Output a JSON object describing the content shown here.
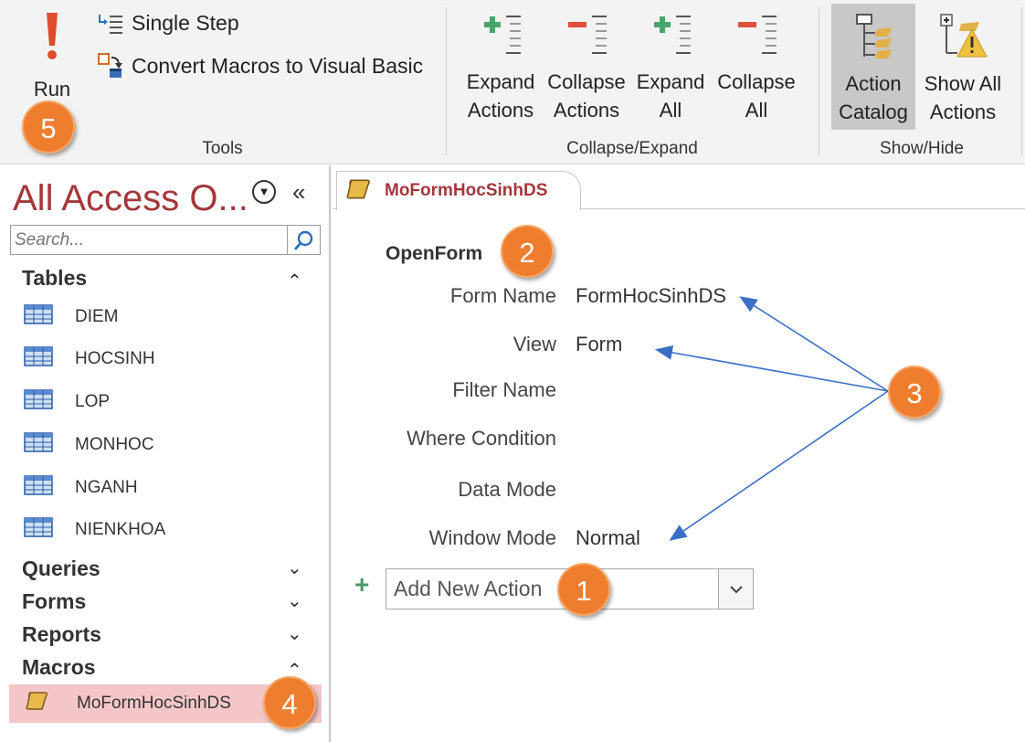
{
  "ribbon": {
    "tools": {
      "run_label": "Run",
      "single_step_label": "Single Step",
      "convert_label": "Convert Macros to Visual Basic",
      "group_label": "Tools"
    },
    "collapse_expand": {
      "expand_actions": [
        "Expand",
        "Actions"
      ],
      "collapse_actions": [
        "Collapse",
        "Actions"
      ],
      "expand_all": [
        "Expand",
        "All"
      ],
      "collapse_all": [
        "Collapse",
        "All"
      ],
      "group_label": "Collapse/Expand"
    },
    "show_hide": {
      "action_catalog": [
        "Action",
        "Catalog"
      ],
      "show_all_actions": [
        "Show All",
        "Actions"
      ],
      "group_label": "Show/Hide"
    }
  },
  "nav": {
    "title": "All Access O...",
    "search_placeholder": "Search...",
    "sections": {
      "tables": "Tables",
      "queries": "Queries",
      "forms": "Forms",
      "reports": "Reports",
      "macros": "Macros"
    },
    "tables": [
      "DIEM",
      "HOCSINH",
      "LOP",
      "MONHOC",
      "NGANH",
      "NIENKHOA"
    ],
    "macros": [
      "MoFormHocSinhDS"
    ]
  },
  "document": {
    "tab_label": "MoFormHocSinhDS",
    "action_name": "OpenForm",
    "arguments": [
      {
        "label": "Form Name",
        "value": "FormHocSinhDS"
      },
      {
        "label": "View",
        "value": "Form"
      },
      {
        "label": "Filter Name",
        "value": ""
      },
      {
        "label": "Where Condition",
        "value": ""
      },
      {
        "label": "Data Mode",
        "value": ""
      },
      {
        "label": "Window Mode",
        "value": "Normal"
      }
    ],
    "add_new_action_value": "Add New Action"
  },
  "callouts": [
    "1",
    "2",
    "3",
    "4",
    "5"
  ],
  "colors": {
    "accent": "#a4373a",
    "callout": "#ee7d2e",
    "selected_item": "#f5c6c8",
    "arrow": "#3b6fc4"
  }
}
